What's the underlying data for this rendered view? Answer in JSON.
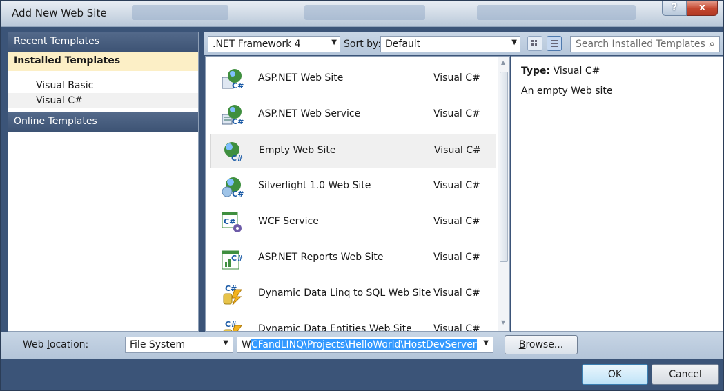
{
  "window": {
    "title": "Add New Web Site",
    "help_glyph": "?",
    "close_glyph": "x"
  },
  "sidebar": {
    "recent": "Recent Templates",
    "installed": "Installed Templates",
    "items": [
      {
        "label": "Visual Basic"
      },
      {
        "label": "Visual C#"
      }
    ],
    "online": "Online Templates"
  },
  "toolbar": {
    "framework": ".NET Framework 4",
    "sort_label": "Sort by:",
    "sort_value": "Default",
    "search_placeholder": "Search Installed Templates"
  },
  "templates": [
    {
      "name": "ASP.NET Web Site",
      "lang": "Visual C#",
      "icon": "web-site-icon"
    },
    {
      "name": "ASP.NET Web Service",
      "lang": "Visual C#",
      "icon": "web-service-icon"
    },
    {
      "name": "Empty Web Site",
      "lang": "Visual C#",
      "icon": "empty-web-site-icon"
    },
    {
      "name": "Silverlight 1.0 Web Site",
      "lang": "Visual C#",
      "icon": "silverlight-web-site-icon"
    },
    {
      "name": "WCF Service",
      "lang": "Visual C#",
      "icon": "wcf-service-icon"
    },
    {
      "name": "ASP.NET Reports Web Site",
      "lang": "Visual C#",
      "icon": "reports-web-site-icon"
    },
    {
      "name": "Dynamic Data Linq to SQL Web Site",
      "lang": "Visual C#",
      "icon": "dynamic-data-linq-icon"
    },
    {
      "name": "Dynamic Data Entities Web Site",
      "lang": "Visual C#",
      "icon": "dynamic-data-entities-icon"
    }
  ],
  "description": {
    "type_label": "Type:",
    "type_value": "Visual C#",
    "text": "An empty Web site"
  },
  "location": {
    "label_pre": "Web ",
    "label_u": "l",
    "label_post": "ocation:",
    "type": "File System",
    "path_first": "W",
    "path_rest": "CFandLINQ\\Projects\\HelloWorld\\HostDevServer",
    "browse_u": "B",
    "browse_rest": "rowse..."
  },
  "buttons": {
    "ok": "OK",
    "cancel": "Cancel"
  },
  "colors": {
    "accent": "#3399ff",
    "frame": "#3b5478",
    "selected_category": "#fcefc6"
  }
}
